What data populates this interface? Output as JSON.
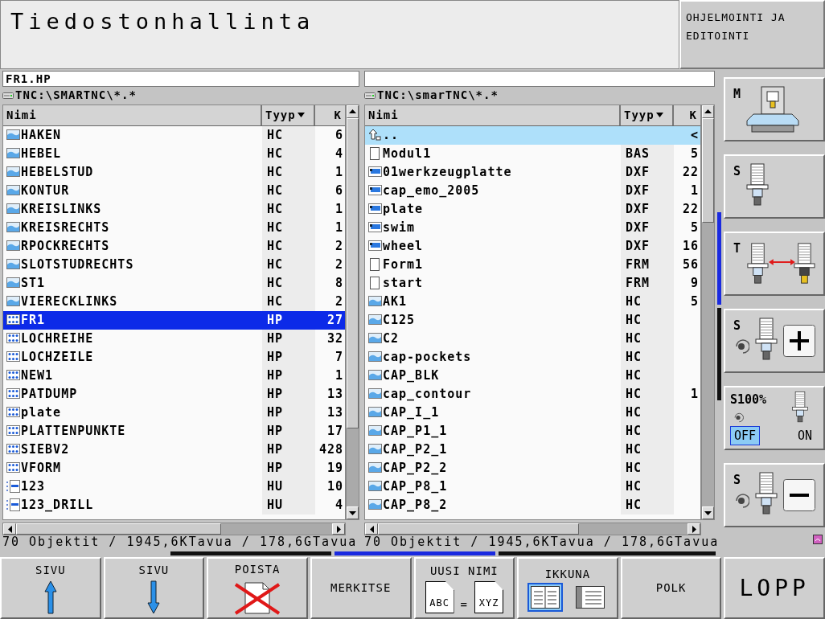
{
  "header": {
    "title": "Tiedostonhallinta",
    "mode": "OHJELMOINTI JA EDITOINTI"
  },
  "panels": [
    {
      "active": true,
      "filename": "FR1.HP",
      "path": "TNC:\\SMARTNC\\*.*",
      "columns": [
        "Nimi",
        "Tyyp",
        "K"
      ],
      "status": "70 Objektit / 1945,6KTavua / 178,6GTavua",
      "rows": [
        {
          "kind": "contour",
          "name": "HAKEN",
          "type": "HC",
          "size": "6",
          "selected": false
        },
        {
          "kind": "contour",
          "name": "HEBEL",
          "type": "HC",
          "size": "4",
          "selected": false
        },
        {
          "kind": "contour",
          "name": "HEBELSTUD",
          "type": "HC",
          "size": "1",
          "selected": false
        },
        {
          "kind": "contour",
          "name": "KONTUR",
          "type": "HC",
          "size": "6",
          "selected": false
        },
        {
          "kind": "contour",
          "name": "KREISLINKS",
          "type": "HC",
          "size": "1",
          "selected": false
        },
        {
          "kind": "contour",
          "name": "KREISRECHTS",
          "type": "HC",
          "size": "1",
          "selected": false
        },
        {
          "kind": "contour",
          "name": "RPOCKRECHTS",
          "type": "HC",
          "size": "2",
          "selected": false
        },
        {
          "kind": "contour",
          "name": "SLOTSTUDRECHTS",
          "type": "HC",
          "size": "2",
          "selected": false
        },
        {
          "kind": "contour",
          "name": "ST1",
          "type": "HC",
          "size": "8",
          "selected": false
        },
        {
          "kind": "contour",
          "name": "VIERECKLINKS",
          "type": "HC",
          "size": "2",
          "selected": false
        },
        {
          "kind": "points",
          "name": "FR1",
          "type": "HP",
          "size": "27",
          "selected": true
        },
        {
          "kind": "points",
          "name": "LOCHREIHE",
          "type": "HP",
          "size": "32",
          "selected": false
        },
        {
          "kind": "points",
          "name": "LOCHZEILE",
          "type": "HP",
          "size": "7",
          "selected": false
        },
        {
          "kind": "points",
          "name": "NEW1",
          "type": "HP",
          "size": "1",
          "selected": false
        },
        {
          "kind": "points",
          "name": "PATDUMP",
          "type": "HP",
          "size": "13",
          "selected": false
        },
        {
          "kind": "points",
          "name": "plate",
          "type": "HP",
          "size": "13",
          "selected": false
        },
        {
          "kind": "points",
          "name": "PLATTENPUNKTE",
          "type": "HP",
          "size": "17",
          "selected": false
        },
        {
          "kind": "points",
          "name": "SIEBV2",
          "type": "HP",
          "size": "428",
          "selected": false
        },
        {
          "kind": "points",
          "name": "VFORM",
          "type": "HP",
          "size": "19",
          "selected": false
        },
        {
          "kind": "table",
          "name": "123",
          "type": "HU",
          "size": "10",
          "selected": false
        },
        {
          "kind": "table",
          "name": "123_DRILL",
          "type": "HU",
          "size": "4",
          "selected": false
        }
      ]
    },
    {
      "active": false,
      "path": "TNC:\\smarTNC\\*.*",
      "columns": [
        "Nimi",
        "Tyyp",
        "K"
      ],
      "status": "70 Objektit / 1945,6KTavua / 178,6GTavua",
      "rows": [
        {
          "kind": "up",
          "name": "..",
          "size": "<",
          "selected": true
        },
        {
          "kind": "file",
          "name": "Modul1",
          "type": "BAS",
          "size": "5",
          "selected": false
        },
        {
          "kind": "dxf",
          "name": "01werkzeugplatte",
          "type": "DXF",
          "size": "22",
          "selected": false
        },
        {
          "kind": "dxf",
          "name": "cap_emo_2005",
          "type": "DXF",
          "size": "1",
          "selected": false
        },
        {
          "kind": "dxf",
          "name": "plate",
          "type": "DXF",
          "size": "22",
          "selected": false
        },
        {
          "kind": "dxf",
          "name": "swim",
          "type": "DXF",
          "size": "5",
          "selected": false
        },
        {
          "kind": "dxf",
          "name": "wheel",
          "type": "DXF",
          "size": "16",
          "selected": false
        },
        {
          "kind": "file",
          "name": "Form1",
          "type": "FRM",
          "size": "56",
          "selected": false
        },
        {
          "kind": "file",
          "name": "start",
          "type": "FRM",
          "size": "9",
          "selected": false
        },
        {
          "kind": "contour",
          "name": "AK1",
          "type": "HC",
          "size": "5",
          "selected": false
        },
        {
          "kind": "contour",
          "name": "C125",
          "type": "HC",
          "selected": false
        },
        {
          "kind": "contour",
          "name": "C2",
          "type": "HC",
          "selected": false
        },
        {
          "kind": "contour",
          "name": "cap-pockets",
          "type": "HC",
          "selected": false
        },
        {
          "kind": "contour",
          "name": "CAP_BLK",
          "type": "HC",
          "selected": false
        },
        {
          "kind": "contour",
          "name": "cap_contour",
          "type": "HC",
          "size": "1",
          "selected": false
        },
        {
          "kind": "contour",
          "name": "CAP_I_1",
          "type": "HC",
          "selected": false
        },
        {
          "kind": "contour",
          "name": "CAP_P1_1",
          "type": "HC",
          "selected": false
        },
        {
          "kind": "contour",
          "name": "CAP_P2_1",
          "type": "HC",
          "selected": false
        },
        {
          "kind": "contour",
          "name": "CAP_P2_2",
          "type": "HC",
          "selected": false
        },
        {
          "kind": "contour",
          "name": "CAP_P8_1",
          "type": "HC",
          "selected": false
        },
        {
          "kind": "contour",
          "name": "CAP_P8_2",
          "type": "HC",
          "selected": false
        }
      ]
    }
  ],
  "side_keys": [
    {
      "kind": "machine",
      "label": "M"
    },
    {
      "kind": "spindle",
      "label": "S"
    },
    {
      "kind": "tool_change",
      "label": "T"
    },
    {
      "kind": "spindle_plus",
      "label": "S"
    },
    {
      "kind": "spindle_toggle",
      "label": "S100%",
      "options": [
        {
          "label": "OFF",
          "selected": true
        },
        {
          "label": "ON",
          "selected": false
        }
      ]
    },
    {
      "kind": "spindle_minus",
      "label": "S"
    }
  ],
  "softkeys": [
    {
      "kind": "page_up",
      "label": "SIVU"
    },
    {
      "kind": "page_down",
      "label": "SIVU"
    },
    {
      "kind": "delete",
      "label": "POISTA"
    },
    {
      "kind": "text",
      "label": "MERKITSE"
    },
    {
      "kind": "rename",
      "label": "UUSI NIMI",
      "from": "ABC",
      "sign": "=",
      "to": "XYZ"
    },
    {
      "kind": "window",
      "label": "IKKUNA",
      "layouts": [
        {
          "kind": "two_pane",
          "selected": true
        },
        {
          "kind": "one_pane",
          "selected": false
        }
      ]
    },
    {
      "kind": "text",
      "label": "POLK"
    },
    {
      "kind": "end",
      "label": "LOPP"
    }
  ]
}
